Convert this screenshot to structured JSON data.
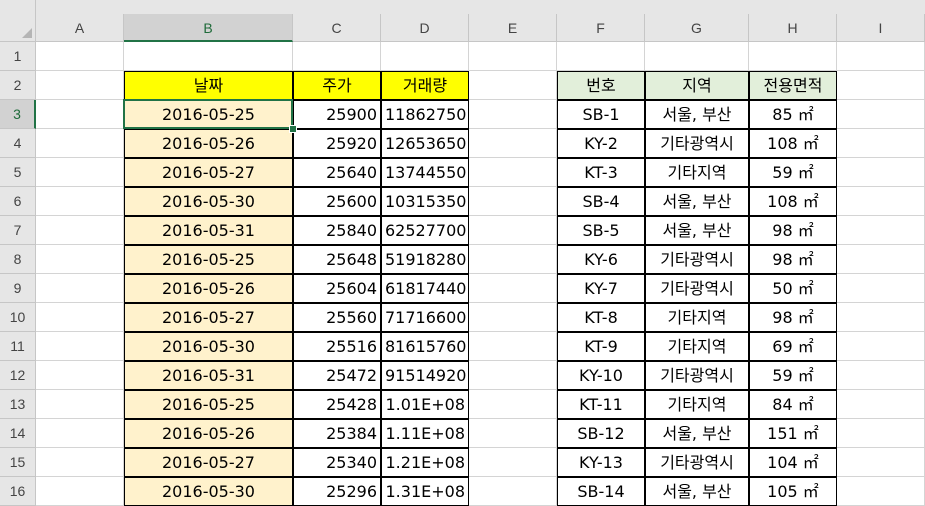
{
  "columns": [
    "A",
    "B",
    "C",
    "D",
    "E",
    "F",
    "G",
    "H",
    "I"
  ],
  "rows": [
    1,
    2,
    3,
    4,
    5,
    6,
    7,
    8,
    9,
    10,
    11,
    12,
    13,
    14,
    15,
    16
  ],
  "headers_left": {
    "date": "날짜",
    "price": "주가",
    "volume": "거래량"
  },
  "headers_right": {
    "id": "번호",
    "region": "지역",
    "area": "전용면적"
  },
  "left_table": [
    {
      "date": "2016-05-25",
      "price": "25900",
      "volume": "11862750"
    },
    {
      "date": "2016-05-26",
      "price": "25920",
      "volume": "12653650"
    },
    {
      "date": "2016-05-27",
      "price": "25640",
      "volume": "13744550"
    },
    {
      "date": "2016-05-30",
      "price": "25600",
      "volume": "10315350"
    },
    {
      "date": "2016-05-31",
      "price": "25840",
      "volume": "62527700"
    },
    {
      "date": "2016-05-25",
      "price": "25648",
      "volume": "51918280"
    },
    {
      "date": "2016-05-26",
      "price": "25604",
      "volume": "61817440"
    },
    {
      "date": "2016-05-27",
      "price": "25560",
      "volume": "71716600"
    },
    {
      "date": "2016-05-30",
      "price": "25516",
      "volume": "81615760"
    },
    {
      "date": "2016-05-31",
      "price": "25472",
      "volume": "91514920"
    },
    {
      "date": "2016-05-25",
      "price": "25428",
      "volume": "1.01E+08"
    },
    {
      "date": "2016-05-26",
      "price": "25384",
      "volume": "1.11E+08"
    },
    {
      "date": "2016-05-27",
      "price": "25340",
      "volume": "1.21E+08"
    },
    {
      "date": "2016-05-30",
      "price": "25296",
      "volume": "1.31E+08"
    }
  ],
  "right_table": [
    {
      "id": "SB-1",
      "region": "서울, 부산",
      "area": "85 ㎡"
    },
    {
      "id": "KY-2",
      "region": "기타광역시",
      "area": "108 ㎡"
    },
    {
      "id": "KT-3",
      "region": "기타지역",
      "area": "59 ㎡"
    },
    {
      "id": "SB-4",
      "region": "서울, 부산",
      "area": "108 ㎡"
    },
    {
      "id": "SB-5",
      "region": "서울, 부산",
      "area": "98 ㎡"
    },
    {
      "id": "KY-6",
      "region": "기타광역시",
      "area": "98 ㎡"
    },
    {
      "id": "KY-7",
      "region": "기타광역시",
      "area": "50 ㎡"
    },
    {
      "id": "KT-8",
      "region": "기타지역",
      "area": "98 ㎡"
    },
    {
      "id": "KT-9",
      "region": "기타지역",
      "area": "69 ㎡"
    },
    {
      "id": "KY-10",
      "region": "기타광역시",
      "area": "59 ㎡"
    },
    {
      "id": "KT-11",
      "region": "기타지역",
      "area": "84 ㎡"
    },
    {
      "id": "SB-12",
      "region": "서울, 부산",
      "area": "151 ㎡"
    },
    {
      "id": "KY-13",
      "region": "기타광역시",
      "area": "104 ㎡"
    },
    {
      "id": "SB-14",
      "region": "서울, 부산",
      "area": "105 ㎡"
    }
  ],
  "selected_cell": "B3"
}
